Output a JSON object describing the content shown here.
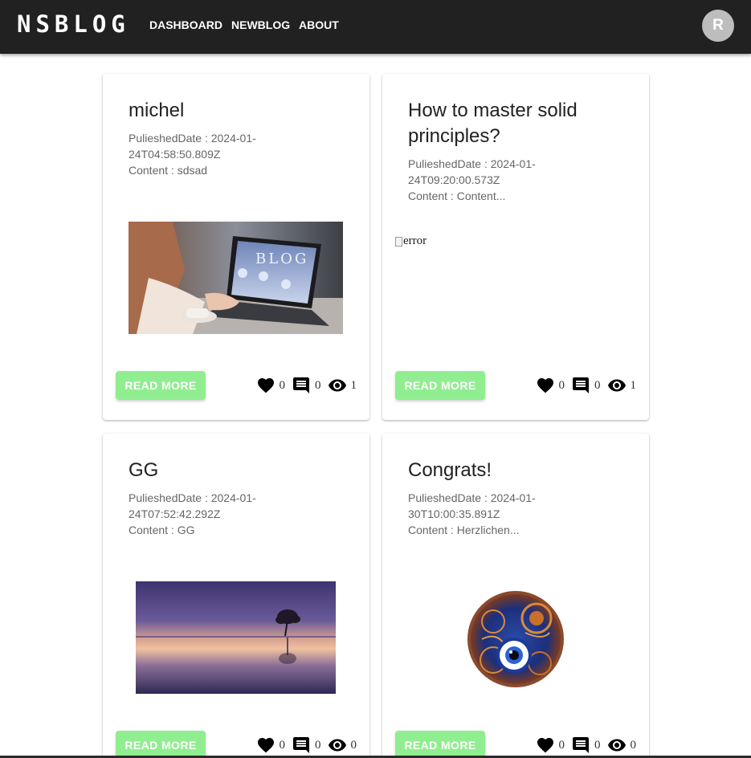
{
  "app": {
    "brand": "NSBLOG",
    "nav": [
      "DASHBOARD",
      "NEWBLOG",
      "ABOUT"
    ],
    "avatar_initial": "R"
  },
  "cards": [
    {
      "title": "michel",
      "published": "PulieshedDate : 2024-01-24T04:58:50.809Z",
      "content": "Content : sdsad",
      "image": "laptop-blog-photo",
      "read_more": "READ MORE",
      "likes": "0",
      "comments": "0",
      "views": "1"
    },
    {
      "title": "How to master solid principles?",
      "published": "PulieshedDate : 2024-01-24T09:20:00.573Z",
      "content": "Content : Content...",
      "image_alt": "error",
      "read_more": "READ MORE",
      "likes": "0",
      "comments": "0",
      "views": "1"
    },
    {
      "title": "GG",
      "published": "PulieshedDate : 2024-01-24T07:52:42.292Z",
      "content": "Content : GG",
      "image": "lake-sunset-tree-photo",
      "read_more": "READ MORE",
      "likes": "0",
      "comments": "0",
      "views": "0"
    },
    {
      "title": "Congrats!",
      "published": "PulieshedDate : 2024-01-30T10:00:35.891Z",
      "content": "Content : Herzlichen...",
      "image": "evil-eye-pendant-photo",
      "read_more": "READ MORE",
      "likes": "0",
      "comments": "0",
      "views": "0"
    }
  ],
  "icons": {
    "like": "heart-icon",
    "comment": "comment-icon",
    "view": "eye-icon"
  },
  "colors": {
    "appbar": "#212121",
    "button": "#90ee90",
    "avatar": "#bdbdbd"
  }
}
